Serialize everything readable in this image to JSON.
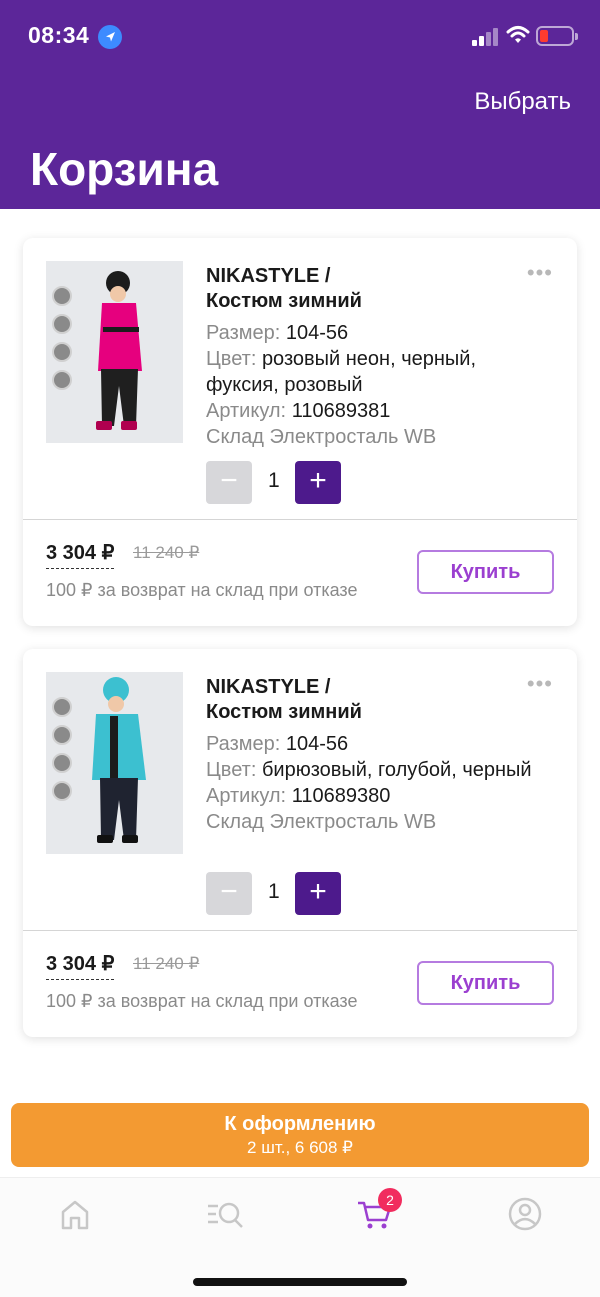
{
  "status_bar": {
    "time": "08:34"
  },
  "header": {
    "select_label": "Выбрать",
    "title": "Корзина"
  },
  "items": [
    {
      "brand": "NIKASTYLE /",
      "name": "Костюм зимний",
      "size_label": "Размер:",
      "size": "104-56",
      "color_label": "Цвет:",
      "color": "розовый неон, черный, фуксия, розовый",
      "article_label": "Артикул:",
      "article": "110689381",
      "warehouse": "Склад Электросталь WB",
      "quantity": "1",
      "minus_symbol": "−",
      "plus_symbol": "+",
      "price": "3 304 ₽",
      "old_price": "11 240 ₽",
      "return_note": "100 ₽ за возврат на склад при отказе",
      "buy_label": "Купить",
      "photo_color": "#e6007e"
    },
    {
      "brand": "NIKASTYLE /",
      "name": "Костюм зимний",
      "size_label": "Размер:",
      "size": "104-56",
      "color_label": "Цвет:",
      "color": "бирюзовый, голубой, черный",
      "article_label": "Артикул:",
      "article": "110689380",
      "warehouse": "Склад Электросталь WB",
      "quantity": "1",
      "minus_symbol": "−",
      "plus_symbol": "+",
      "price": "3 304 ₽",
      "old_price": "11 240 ₽",
      "return_note": "100 ₽ за возврат на склад при отказе",
      "buy_label": "Купить",
      "photo_color": "#3cc0d0"
    }
  ],
  "checkout": {
    "label": "К оформлению",
    "summary": "2 шт., 6 608 ₽"
  },
  "tabbar": {
    "items": [
      "home-icon",
      "catalog-search-icon",
      "cart-icon",
      "profile-icon"
    ],
    "cart_badge": "2",
    "active_color": "#9b3fd0",
    "inactive_color": "#c7c7c7"
  },
  "colors": {
    "header": "#5c2699",
    "plus": "#4d1a8c",
    "checkout": "#f39a32",
    "badge": "#f12c5e"
  }
}
